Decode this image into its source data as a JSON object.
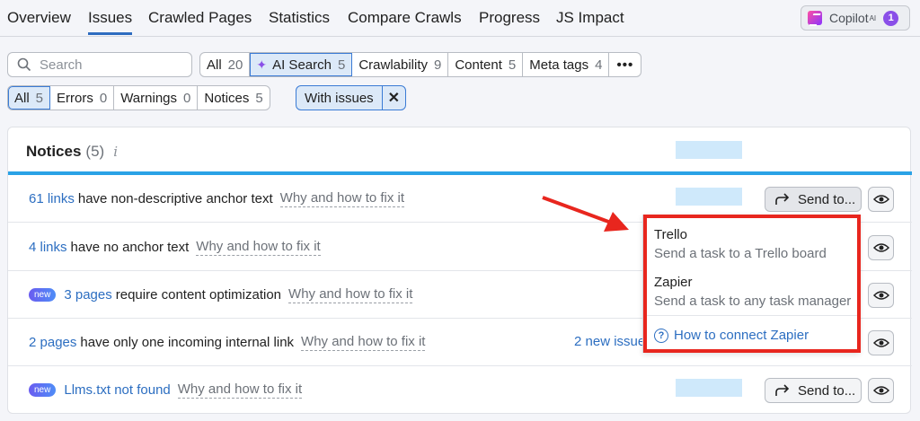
{
  "nav": {
    "tabs": [
      "Overview",
      "Issues",
      "Crawled Pages",
      "Statistics",
      "Compare Crawls",
      "Progress",
      "JS Impact"
    ],
    "active_tab": "Issues",
    "copilot_label": "Copilot",
    "copilot_sup": "AI",
    "copilot_badge": "1"
  },
  "search": {
    "placeholder": "Search",
    "value": ""
  },
  "category_filters": [
    {
      "label": "All",
      "count": "20"
    },
    {
      "label": "AI Search",
      "count": "5",
      "icon": "sparkle-icon",
      "selected": true
    },
    {
      "label": "Crawlability",
      "count": "9"
    },
    {
      "label": "Content",
      "count": "5"
    },
    {
      "label": "Meta tags",
      "count": "4"
    }
  ],
  "more_label": "•••",
  "type_filters": [
    {
      "label": "All",
      "count": "5",
      "selected": true
    },
    {
      "label": "Errors",
      "count": "0"
    },
    {
      "label": "Warnings",
      "count": "0"
    },
    {
      "label": "Notices",
      "count": "5"
    }
  ],
  "chip": {
    "label": "With issues",
    "close": "✕"
  },
  "panel": {
    "title": "Notices",
    "count": "(5)",
    "info": "i"
  },
  "rows": [
    {
      "link": "61 links",
      "text": "have non-descriptive anchor text",
      "why": "Why and how to fix it",
      "new": false
    },
    {
      "link": "4 links",
      "text": "have no anchor text",
      "why": "Why and how to fix it",
      "new": false
    },
    {
      "link": "3 pages",
      "text": "require content optimization",
      "why": "Why and how to fix it",
      "new": true,
      "badge": "new"
    },
    {
      "link": "2 pages",
      "text": "have only one incoming internal link",
      "why": "Why and how to fix it",
      "new": false,
      "extra": "2 new issue"
    },
    {
      "link": "Llms.txt not found",
      "text": "",
      "why": "Why and how to fix it",
      "new": true,
      "badge": "new"
    }
  ],
  "send_label": "Send to...",
  "dropdown": {
    "items": [
      {
        "title": "Trello",
        "desc": "Send a task to a Trello board"
      },
      {
        "title": "Zapier",
        "desc": "Send a task to any task manager"
      }
    ],
    "link": "How to connect Zapier",
    "link_icon": "?"
  },
  "colors": {
    "accent": "#2c6ec1",
    "highlight_box": "#e8261e",
    "panel_bar": "#2aa2e6"
  }
}
